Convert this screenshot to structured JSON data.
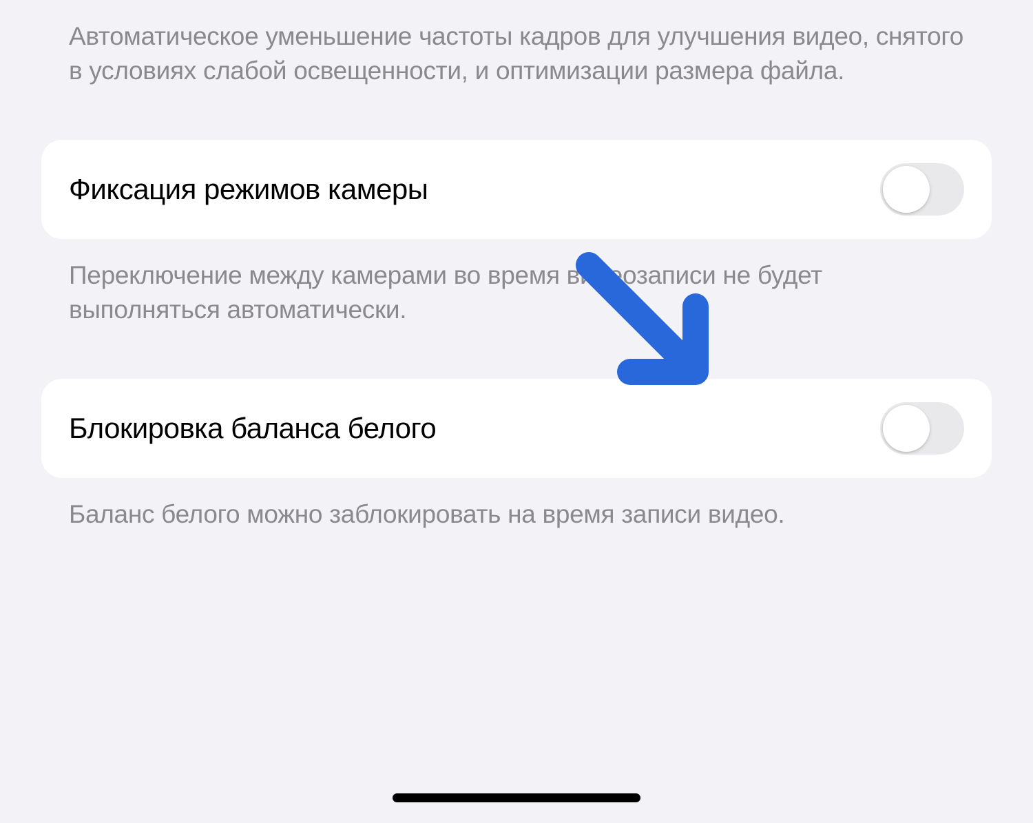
{
  "section1": {
    "footer": "Автоматическое уменьшение частоты кадров для улучшения видео, снятого в условиях слабой освещенности, и оптимизации размера файла."
  },
  "section2": {
    "label": "Фиксация режимов камеры",
    "toggle": false,
    "footer": "Переключение между камерами во время видеозаписи не будет выполняться автоматически."
  },
  "section3": {
    "label": "Блокировка баланса белого",
    "toggle": false,
    "footer": "Баланс белого можно заблокировать на время записи видео."
  },
  "annotation": {
    "color": "#2968db"
  }
}
